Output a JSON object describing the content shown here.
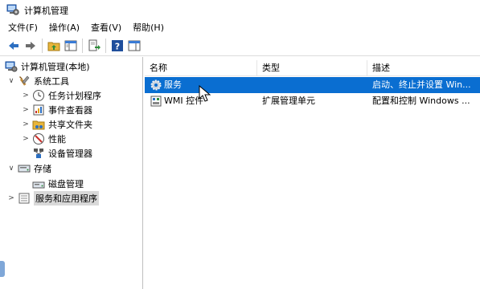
{
  "window": {
    "title": "计算机管理"
  },
  "menu": [
    "文件(F)",
    "操作(A)",
    "查看(V)",
    "帮助(H)"
  ],
  "toolbar": {
    "buttons": [
      "back-arrow-icon",
      "forward-arrow-icon",
      "up-folder-icon",
      "show-hide-tree-icon",
      "export-list-icon",
      "help-icon",
      "properties-icon"
    ]
  },
  "tree": {
    "root": "计算机管理(本地)",
    "system_tools": "系统工具",
    "task_scheduler": "任务计划程序",
    "event_viewer": "事件查看器",
    "shared_folders": "共享文件夹",
    "performance": "性能",
    "device_manager": "设备管理器",
    "storage": "存储",
    "disk_management": "磁盘管理",
    "services_apps": "服务和应用程序"
  },
  "list": {
    "columns": {
      "name": "名称",
      "type": "类型",
      "description": "描述"
    },
    "rows": [
      {
        "name": "服务",
        "type": "",
        "description": "启动、终止并设置 Win..."
      },
      {
        "name": "WMI 控件",
        "type": "扩展管理单元",
        "description": "配置和控制 Windows ..."
      }
    ]
  },
  "colors": {
    "selection": "#0a6ed1",
    "tree_selection": "#d9d9d9"
  }
}
